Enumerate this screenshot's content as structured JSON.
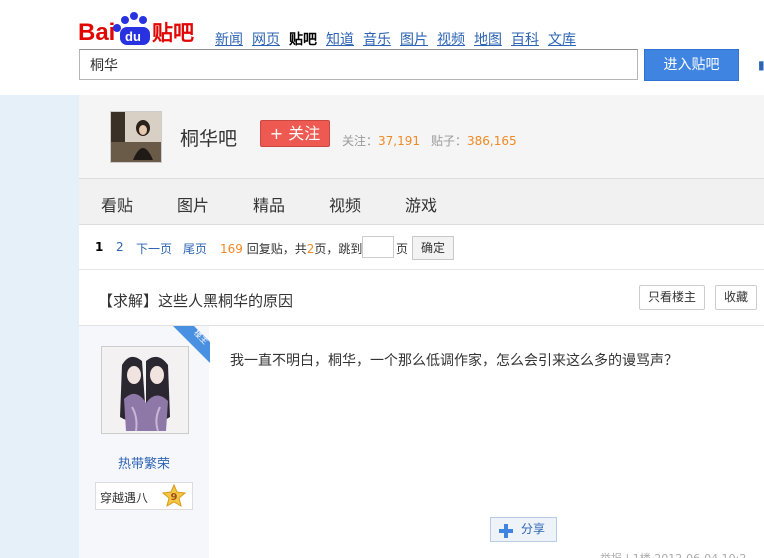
{
  "header": {
    "logo_text": "Baidu贴吧",
    "nav": [
      "新闻",
      "网页",
      "贴吧",
      "知道",
      "音乐",
      "图片",
      "视频",
      "地图",
      "百科",
      "文库"
    ],
    "nav_current_index": 2,
    "search_value": "桐华",
    "search_button": "进入贴吧"
  },
  "forum": {
    "name": "桐华吧",
    "follow_label": "+ 关注",
    "followers_label": "关注：",
    "followers": "37,191",
    "posts_label": "贴子：",
    "posts": "386,165",
    "avatar_icon": "forum-avatar-photo"
  },
  "tabs": [
    "看贴",
    "图片",
    "精品",
    "视频",
    "游戏"
  ],
  "pager": {
    "current": "1",
    "page2": "2",
    "next": "下一页",
    "last": "尾页",
    "reply_count": "169",
    "reply_text": "回复贴，共",
    "total_pages": "2",
    "pages_text": "页，跳到",
    "page_suffix": "页",
    "confirm": "确定"
  },
  "thread": {
    "title": "【求解】这些人黑桐华的原因",
    "only_author": "只看楼主",
    "favorite": "收藏"
  },
  "post": {
    "floor_tag": "楼主",
    "author": "热带繁荣",
    "badge_label": "穿越遇八",
    "badge_level": "9",
    "content": "我一直不明白，桐华，一个那么低调作家，怎么会引来这么多的谩骂声？",
    "share": "分享",
    "meta_fragment": "举报 | 1楼 2012-06-04 10:2"
  },
  "colors": {
    "link": "#2d64b3",
    "accent_orange": "#f08a24",
    "follow_red": "#ee5a52",
    "search_blue": "#3f84e1",
    "floor_tag_blue": "#4a90e2"
  }
}
